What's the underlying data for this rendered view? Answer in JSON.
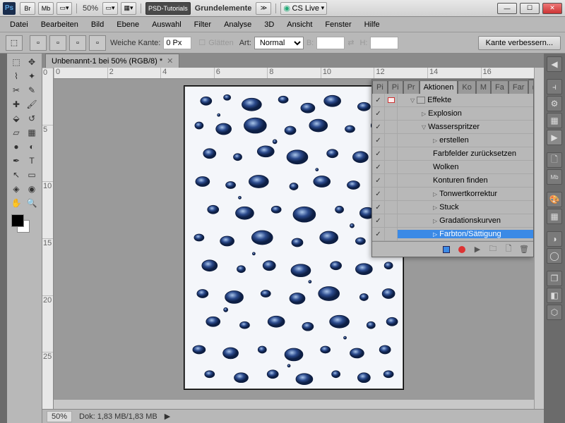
{
  "titlebar": {
    "br": "Br",
    "mb": "Mb",
    "zoom": "50%",
    "psd_tutorials": "PSD-Tutorials",
    "grundelemente": "Grundelemente",
    "cslive": "CS Live"
  },
  "menu": [
    "Datei",
    "Bearbeiten",
    "Bild",
    "Ebene",
    "Auswahl",
    "Filter",
    "Analyse",
    "3D",
    "Ansicht",
    "Fenster",
    "Hilfe"
  ],
  "options": {
    "weiche_kante": "Weiche Kante:",
    "wk_value": "0 Px",
    "glaetten": "Glätten",
    "art": "Art:",
    "art_value": "Normal",
    "b": "B:",
    "h": "H:",
    "kante": "Kante verbessern..."
  },
  "doc": {
    "tab": "Unbenannt-1 bei 50% (RGB/8) *"
  },
  "ruler_h": [
    "0",
    "2",
    "4",
    "6",
    "8",
    "10",
    "12",
    "14",
    "16"
  ],
  "ruler_v": [
    "0",
    "5",
    "10",
    "15",
    "20",
    "25"
  ],
  "panel": {
    "tabs_left": [
      "Pi",
      "Pi",
      "Pr"
    ],
    "tab_active": "Aktionen",
    "tabs_right": [
      "Ko",
      "M",
      "Fa",
      "Far"
    ],
    "rows": [
      {
        "chk": true,
        "mod": true,
        "lvl": 0,
        "arrow": "down",
        "folder": true,
        "label": "Effekte"
      },
      {
        "chk": true,
        "mod": false,
        "lvl": 1,
        "arrow": "right",
        "label": "Explosion"
      },
      {
        "chk": true,
        "mod": false,
        "lvl": 1,
        "arrow": "down",
        "label": "Wasserspritzer"
      },
      {
        "chk": true,
        "mod": false,
        "lvl": 2,
        "arrow": "right",
        "label": "erstellen"
      },
      {
        "chk": true,
        "mod": false,
        "lvl": 2,
        "arrow": "",
        "label": "Farbfelder zurücksetzen"
      },
      {
        "chk": true,
        "mod": false,
        "lvl": 2,
        "arrow": "",
        "label": "Wolken"
      },
      {
        "chk": true,
        "mod": false,
        "lvl": 2,
        "arrow": "",
        "label": "Konturen finden"
      },
      {
        "chk": true,
        "mod": false,
        "lvl": 2,
        "arrow": "right",
        "label": "Tonwertkorrektur"
      },
      {
        "chk": true,
        "mod": false,
        "lvl": 2,
        "arrow": "right",
        "label": "Stuck"
      },
      {
        "chk": true,
        "mod": false,
        "lvl": 2,
        "arrow": "right",
        "label": "Gradationskurven"
      },
      {
        "chk": true,
        "mod": false,
        "lvl": 2,
        "arrow": "right",
        "label": "Farbton/Sättigung",
        "sel": true
      }
    ]
  },
  "status": {
    "zoom": "50%",
    "dok": "Dok: 1,83 MB/1,83 MB"
  }
}
